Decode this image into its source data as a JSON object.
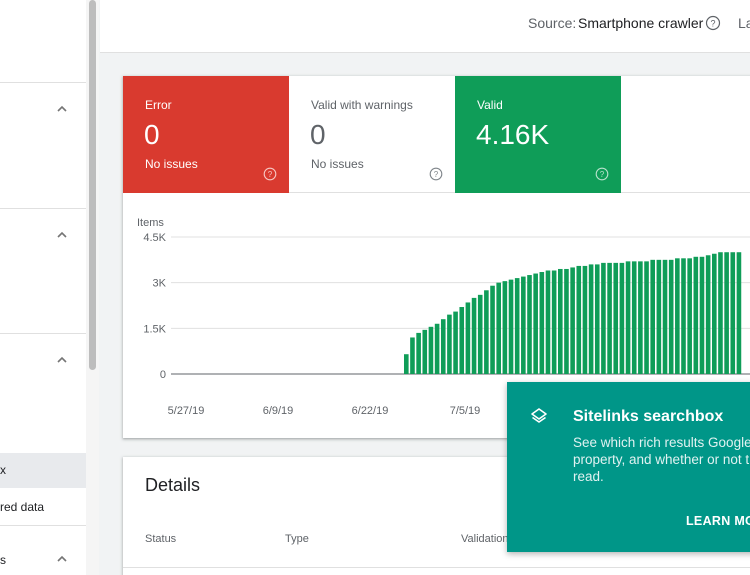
{
  "colors": {
    "error": "#d93a2f",
    "valid": "#0f9d58",
    "popup": "#009688"
  },
  "sidebar": {
    "items": [
      {
        "label": "x"
      },
      {
        "label": "red data"
      },
      {
        "label": "s"
      }
    ]
  },
  "header": {
    "source_label": "Source:",
    "source_value": "Smartphone crawler",
    "cut_text": "La"
  },
  "status": {
    "tiles": [
      {
        "label": "Error",
        "value": "0",
        "sub": "No issues"
      },
      {
        "label": "Valid with warnings",
        "value": "0",
        "sub": "No issues"
      },
      {
        "label": "Valid",
        "value": "4.16K",
        "sub": ""
      }
    ]
  },
  "chart_data": {
    "type": "bar",
    "ylabel": "Items",
    "yticks": [
      "0",
      "1.5K",
      "3K",
      "4.5K"
    ],
    "ylim": [
      0,
      4500
    ],
    "xticks": [
      "5/27/19",
      "6/9/19",
      "6/22/19",
      "7/5/19"
    ],
    "grid": true,
    "series": [
      {
        "values": [
          650,
          1200,
          1350,
          1450,
          1550,
          1650,
          1800,
          1950,
          2050,
          2200,
          2350,
          2500,
          2600,
          2750,
          2900,
          3000,
          3050,
          3100,
          3150,
          3200,
          3250,
          3300,
          3350,
          3400,
          3400,
          3450,
          3450,
          3500,
          3550,
          3550,
          3600,
          3600,
          3650,
          3650,
          3650,
          3650,
          3700,
          3700,
          3700,
          3700,
          3750,
          3750,
          3750,
          3750,
          3800,
          3800,
          3800,
          3850,
          3850,
          3900,
          3950,
          4000,
          4000,
          4000,
          4000
        ]
      }
    ]
  },
  "details": {
    "title": "Details",
    "columns": [
      "Status",
      "Type",
      "Validation"
    ]
  },
  "popup": {
    "icon": "layers-icon",
    "title": "Sitelinks searchbox",
    "body_lines": [
      "See which rich results Google",
      "property, and whether or not t",
      "read."
    ],
    "action": "LEARN MO"
  }
}
